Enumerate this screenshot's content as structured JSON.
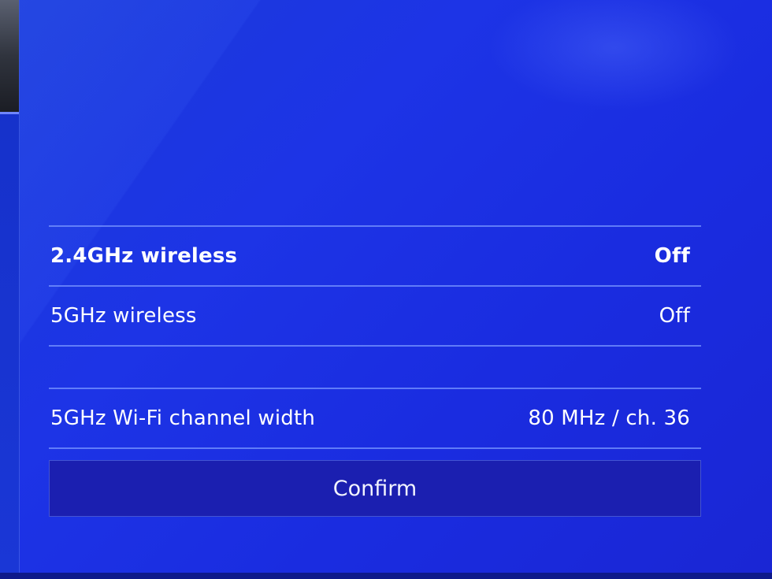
{
  "settings": {
    "rows": [
      {
        "label": "2.4GHz wireless",
        "value": "Off"
      },
      {
        "label": "5GHz wireless",
        "value": "Off"
      },
      {
        "label": "5GHz Wi-Fi channel width",
        "value": "80 MHz / ch. 36"
      }
    ]
  },
  "confirm_label": "Confirm",
  "colors": {
    "background": "#1d34e6",
    "divider": "#7896ff",
    "button": "#1b1fb0",
    "text": "#ffffff"
  }
}
